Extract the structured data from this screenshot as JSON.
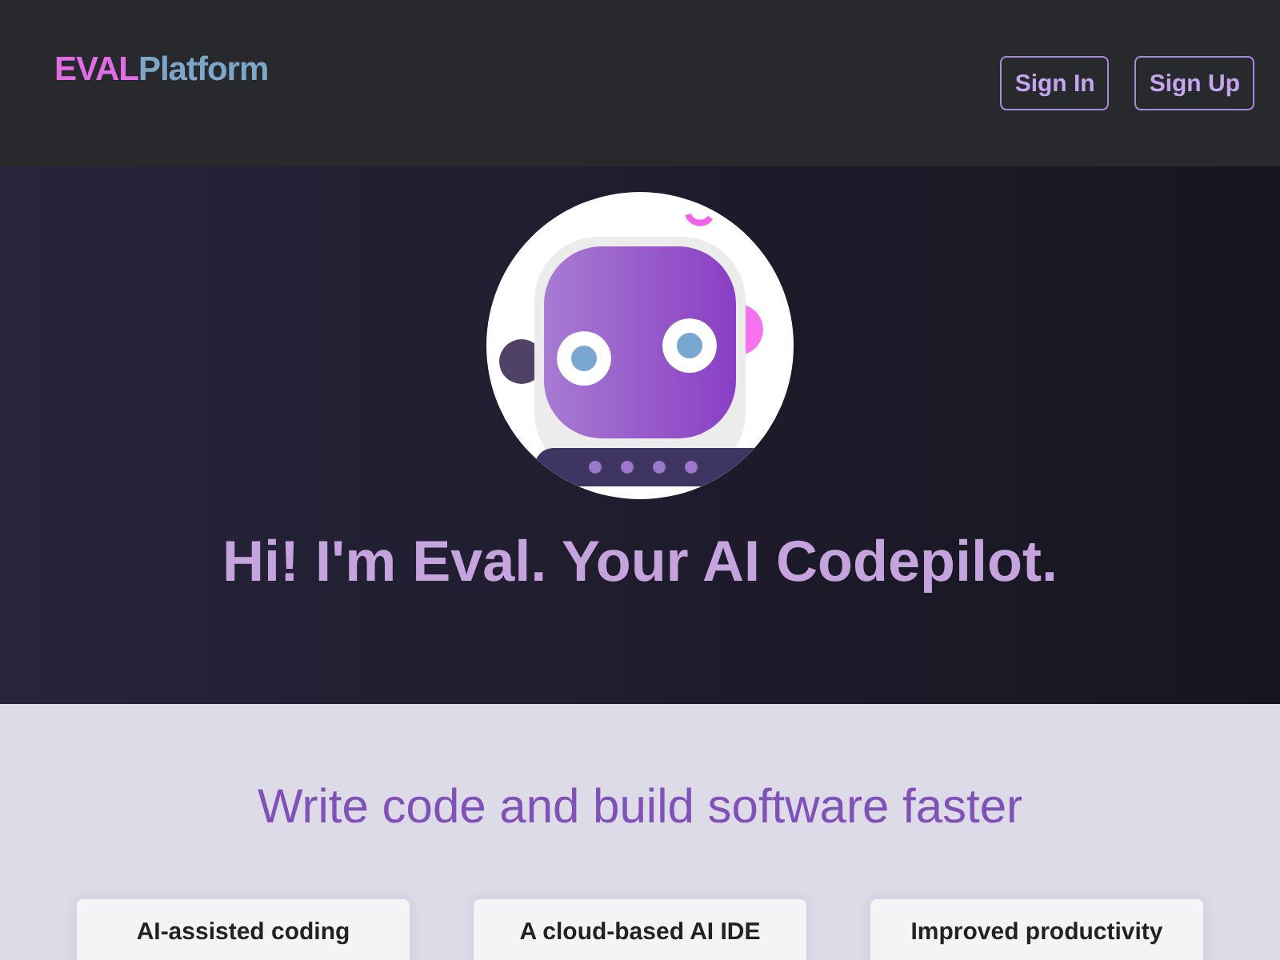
{
  "header": {
    "logo": {
      "accent": "EVAL",
      "rest": "Platform"
    },
    "buttons": [
      "Sign In",
      "Sign Up"
    ]
  },
  "hero": {
    "headline": "Hi! I'm Eval. Your AI Codepilot."
  },
  "features": {
    "title": "Write code and build software faster",
    "cards": [
      {
        "title": "AI-assisted coding"
      },
      {
        "title": "A cloud-based AI IDE"
      },
      {
        "title": "Improved productivity"
      }
    ]
  }
}
